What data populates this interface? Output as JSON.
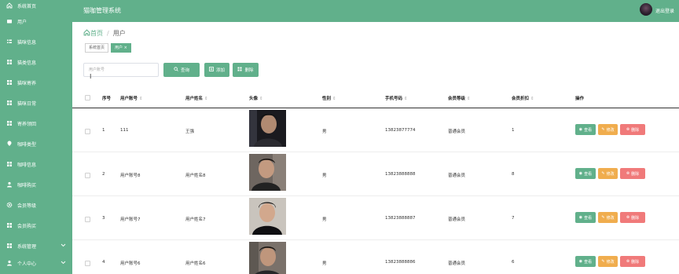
{
  "app": {
    "title": "猫咖管理系统",
    "logout_label": "退出登录"
  },
  "sidebar": {
    "items": [
      {
        "label": "系统首页",
        "icon": "home-icon"
      },
      {
        "label": "用户",
        "icon": "user-card-icon"
      },
      {
        "label": "猫咪信息",
        "icon": "list-icon"
      },
      {
        "label": "猫类信息",
        "icon": "grid-icon"
      },
      {
        "label": "猫咪寄养",
        "icon": "grid-icon"
      },
      {
        "label": "猫咪日常",
        "icon": "grid-icon"
      },
      {
        "label": "寄养领回",
        "icon": "grid-icon"
      },
      {
        "label": "咖啡类型",
        "icon": "pin-icon"
      },
      {
        "label": "咖啡信息",
        "icon": "grid-icon"
      },
      {
        "label": "咖啡购买",
        "icon": "person-icon"
      },
      {
        "label": "会员等级",
        "icon": "gear-icon"
      },
      {
        "label": "会员购买",
        "icon": "grid-icon"
      },
      {
        "label": "系统管理",
        "icon": "grid-icon",
        "chevron": true
      },
      {
        "label": "个人中心",
        "icon": "person-icon",
        "chevron": true
      }
    ]
  },
  "breadcrumb": {
    "home": "首页",
    "separator": "/",
    "current": "用户"
  },
  "tags": [
    {
      "label": "系统首页"
    },
    {
      "label": "用户 ×"
    }
  ],
  "search": {
    "placeholder": "用户账号"
  },
  "toolbar": {
    "search_label": "查询",
    "add_label": "添加",
    "delete_label": "删除"
  },
  "table": {
    "columns": [
      "序号",
      "用户账号",
      "用户姓名",
      "头像",
      "性别",
      "手机号码",
      "会员等级",
      "会员折扣",
      "操作"
    ],
    "rows": [
      {
        "index": "1",
        "account": "111",
        "name": "王强",
        "gender": "男",
        "phone": "13823877774",
        "level": "普通会员",
        "discount": "1"
      },
      {
        "index": "2",
        "account": "用户账号8",
        "name": "用户姓名8",
        "gender": "男",
        "phone": "13823888888",
        "level": "普通会员",
        "discount": "8"
      },
      {
        "index": "3",
        "account": "用户账号7",
        "name": "用户姓名7",
        "gender": "男",
        "phone": "13823888887",
        "level": "普通会员",
        "discount": "7"
      },
      {
        "index": "4",
        "account": "用户账号6",
        "name": "用户姓名6",
        "gender": "男",
        "phone": "13823888886",
        "level": "普通会员",
        "discount": "6"
      }
    ],
    "actions": {
      "view": "查看",
      "edit": "修改",
      "delete": "删除"
    }
  },
  "colors": {
    "primary": "#61b08b",
    "warning": "#f0ad4e",
    "danger": "#f07a7a"
  }
}
